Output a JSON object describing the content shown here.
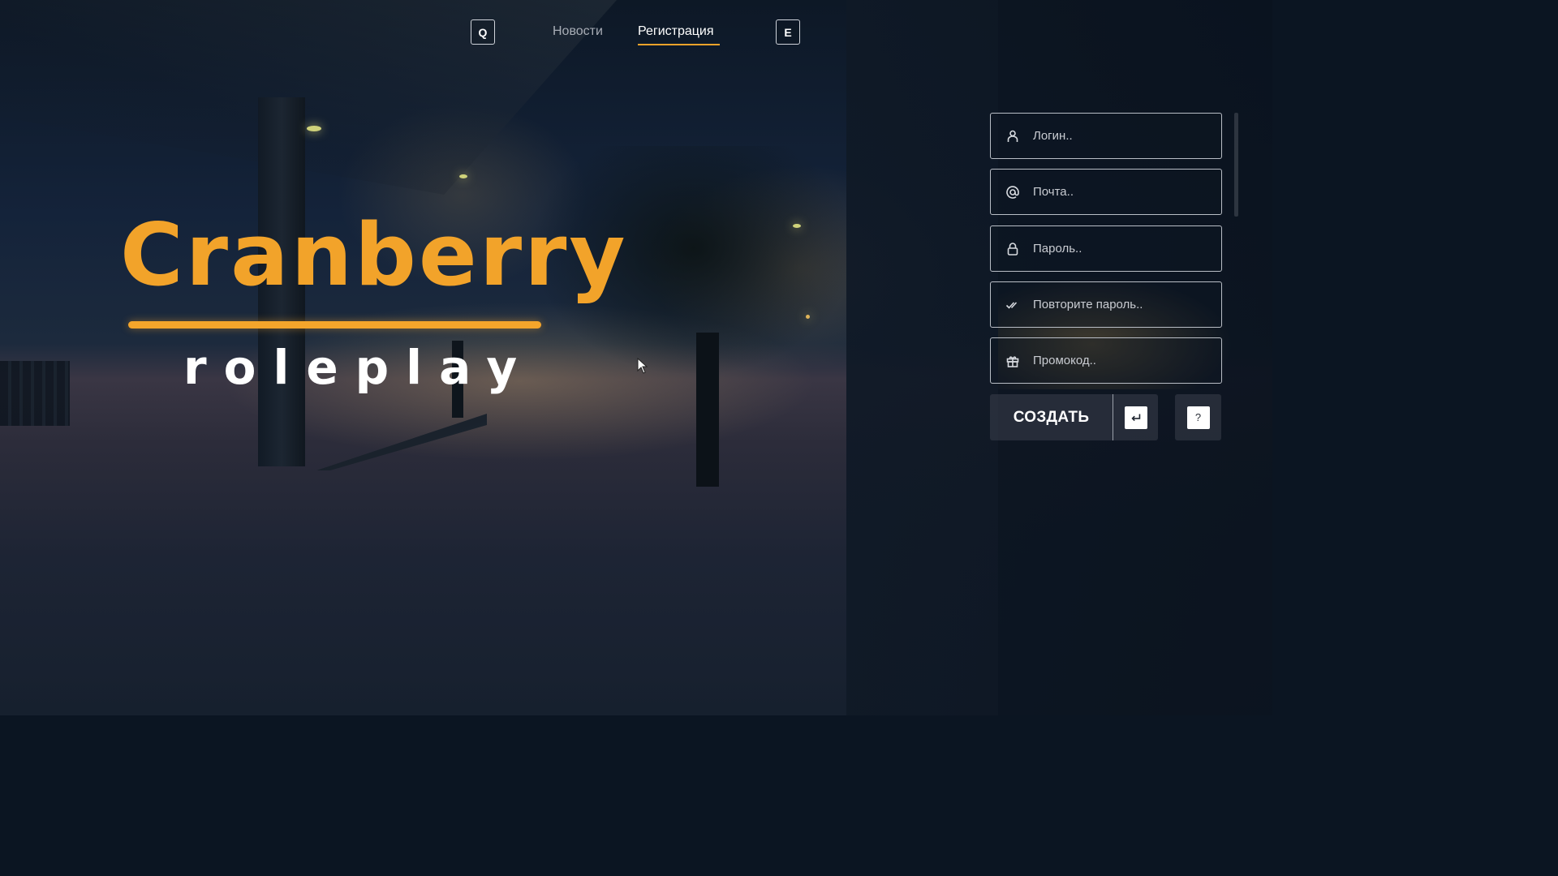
{
  "nav": {
    "prev_key": "Q",
    "next_key": "E",
    "tabs": [
      {
        "label": "Новости",
        "active": false
      },
      {
        "label": "Регистрация",
        "active": true
      }
    ],
    "accent_color": "#f2a32a"
  },
  "logo": {
    "title": "Cranberry",
    "subtitle": "roleplay"
  },
  "form": {
    "fields": [
      {
        "icon": "user-icon",
        "placeholder": "Логин..",
        "value": ""
      },
      {
        "icon": "at-icon",
        "placeholder": "Почта..",
        "value": ""
      },
      {
        "icon": "lock-icon",
        "placeholder": "Пароль..",
        "value": ""
      },
      {
        "icon": "double-check-icon",
        "placeholder": "Повторите пароль..",
        "value": ""
      },
      {
        "icon": "gift-icon",
        "placeholder": "Промокод..",
        "value": ""
      }
    ],
    "submit_label": "СОЗДАТЬ",
    "submit_key_icon": "enter-key-icon",
    "help_label": "?"
  }
}
